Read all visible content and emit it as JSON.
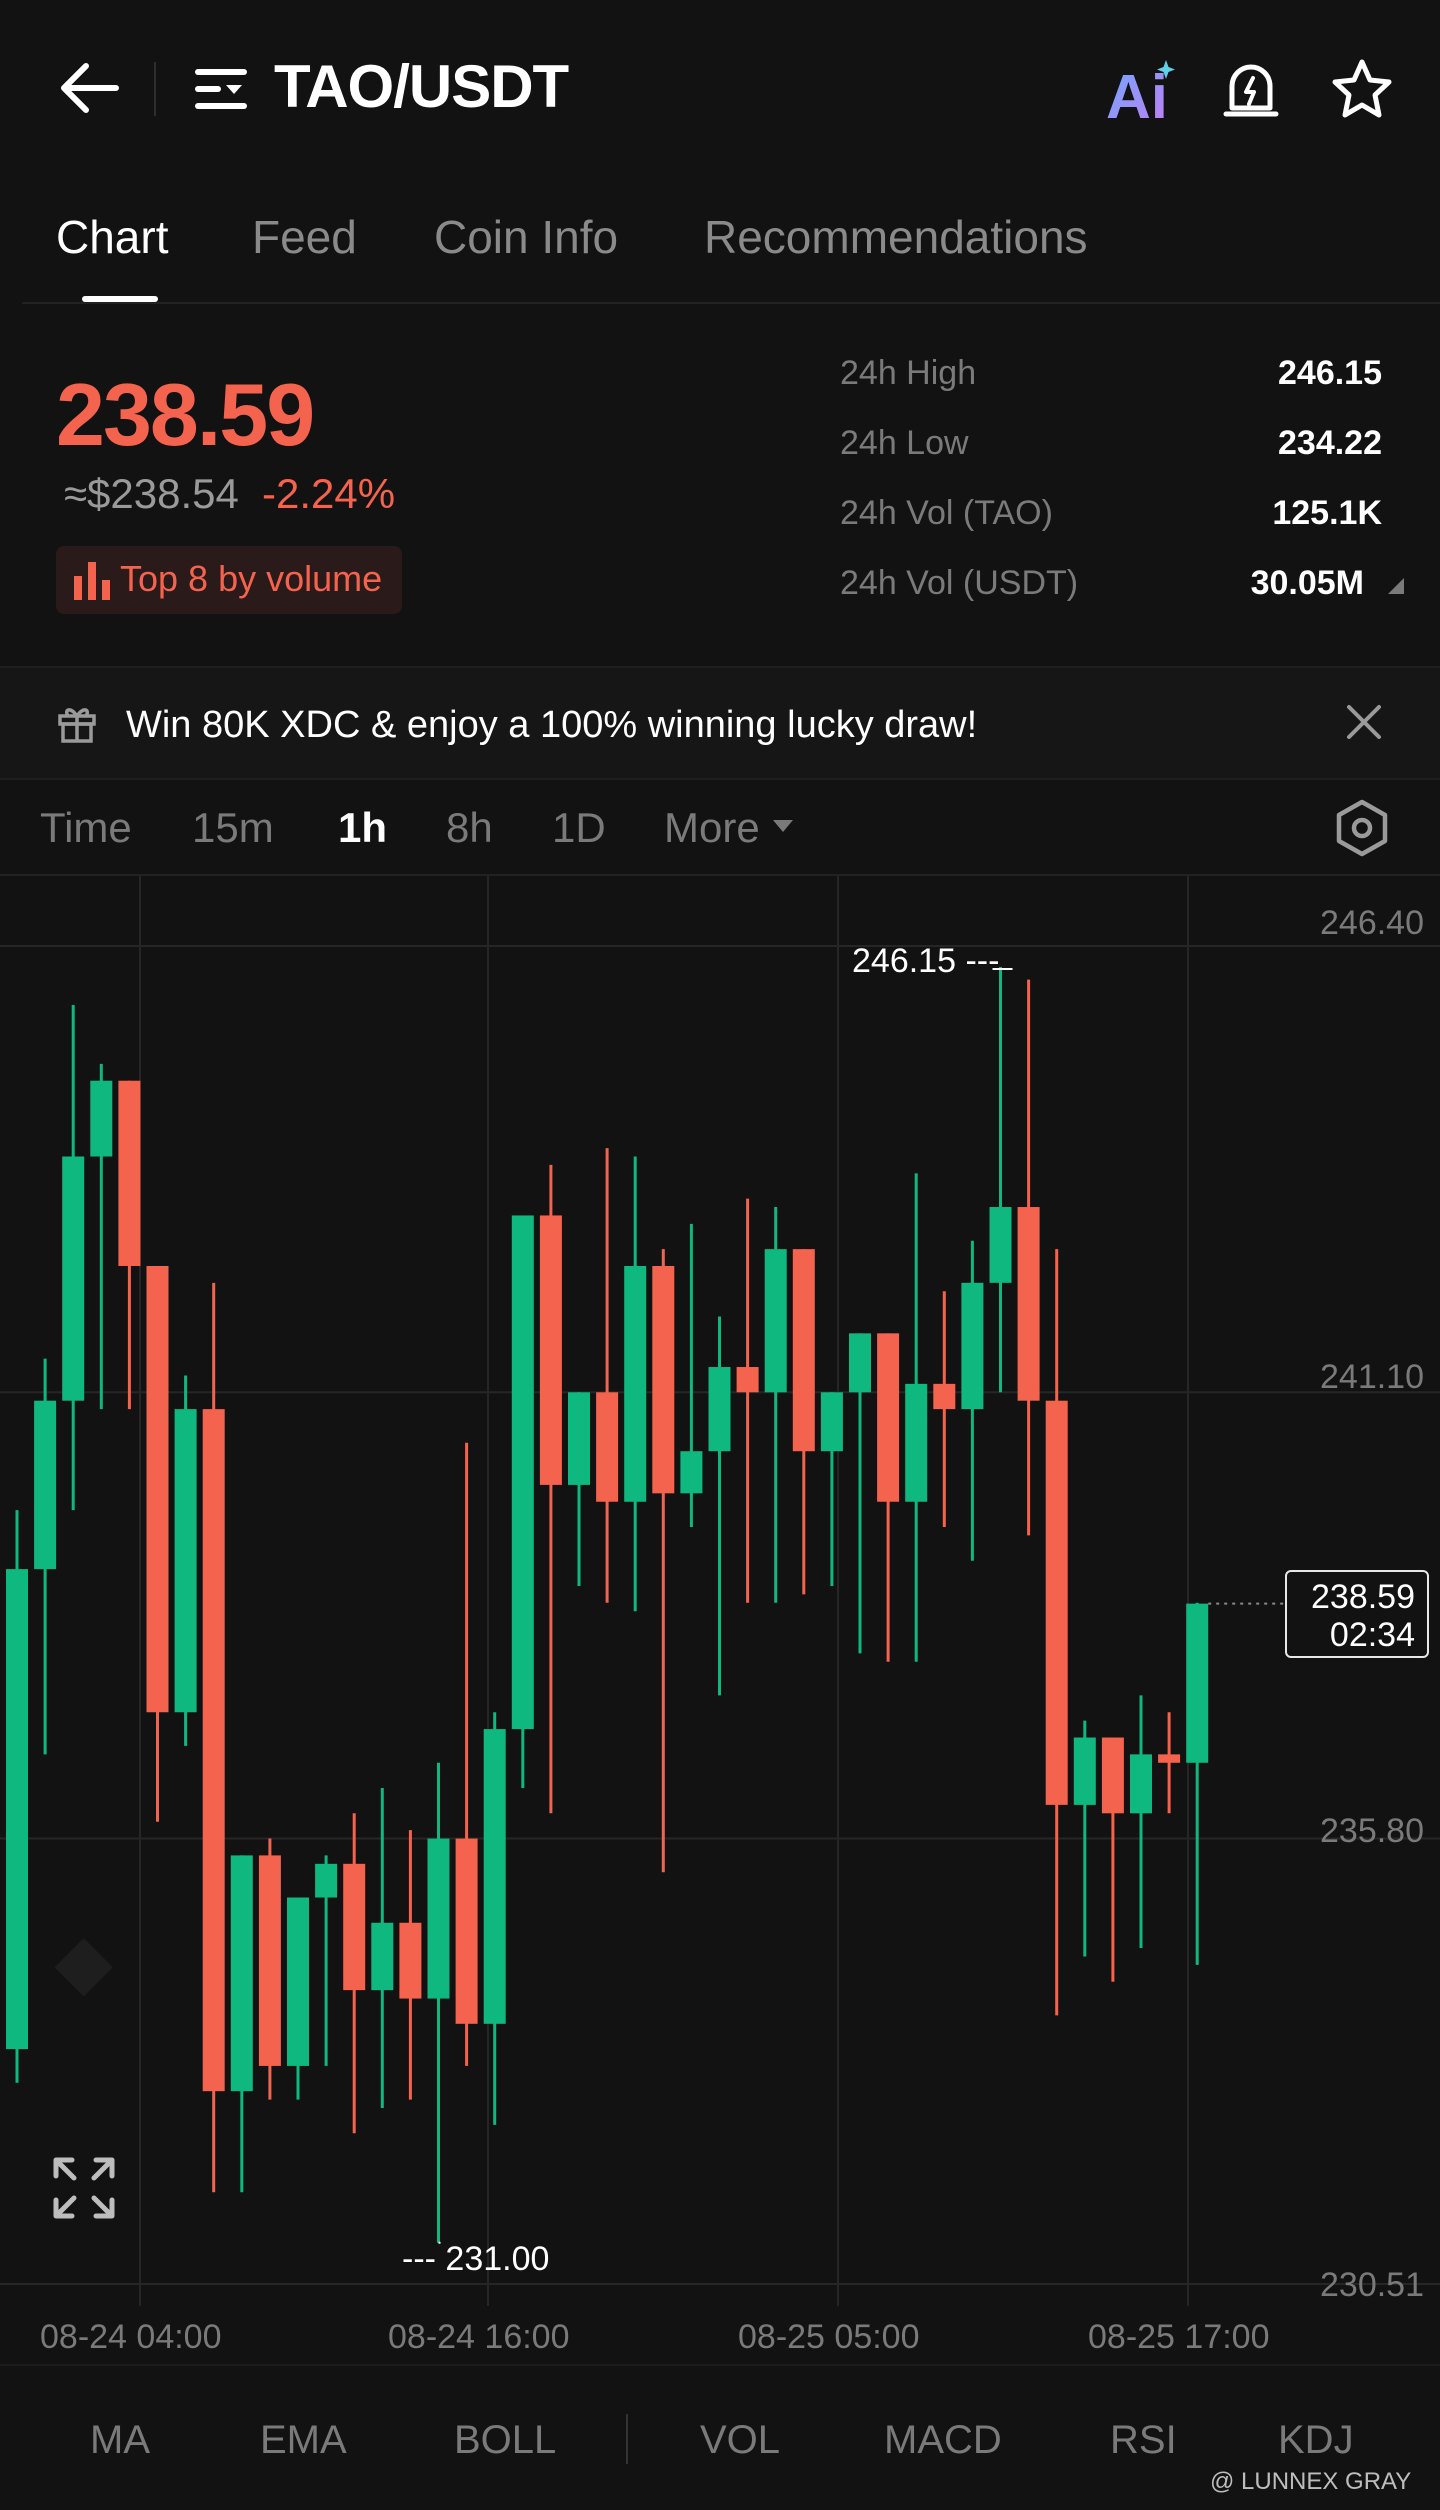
{
  "header": {
    "title": "TAO/USDT",
    "ai_label": "Ai"
  },
  "tabs": [
    {
      "label": "Chart",
      "active": true
    },
    {
      "label": "Feed"
    },
    {
      "label": "Coin Info"
    },
    {
      "label": "Recommendations"
    }
  ],
  "ticker": {
    "price": "238.59",
    "usd_price": "≈$238.54",
    "change": "-2.24%",
    "badge": "Top 8 by volume",
    "stats": [
      {
        "label": "24h High",
        "value": "246.15"
      },
      {
        "label": "24h Low",
        "value": "234.22"
      },
      {
        "label": "24h Vol (TAO)",
        "value": "125.1K"
      },
      {
        "label": "24h Vol (USDT)",
        "value": "30.05M"
      }
    ]
  },
  "promo": {
    "text": "Win 80K XDC & enjoy a 100% winning lucky draw!"
  },
  "intervals": [
    {
      "label": "Time"
    },
    {
      "label": "15m"
    },
    {
      "label": "1h",
      "active": true
    },
    {
      "label": "8h"
    },
    {
      "label": "1D"
    },
    {
      "label": "More"
    }
  ],
  "indicators": [
    "MA",
    "EMA",
    "BOLL",
    "VOL",
    "MACD",
    "RSI",
    "KDJ"
  ],
  "watermark": "@ LUNNEX GRAY",
  "colors": {
    "up": "#0fb87f",
    "down": "#f4634d",
    "accent_ai": "#8e7cf0"
  },
  "chart_data": {
    "type": "candlestick",
    "y_ticks": [
      "246.40",
      "241.10",
      "235.80",
      "230.51"
    ],
    "ylim": [
      230.51,
      246.4
    ],
    "x_ticks": [
      "08-24 04:00",
      "08-24 16:00",
      "08-25 05:00",
      "08-25 17:00"
    ],
    "high_marker": "246.15",
    "low_marker": "231.00",
    "last_price": "238.59",
    "countdown": "02:34",
    "candles": [
      {
        "o": 233.3,
        "h": 239.7,
        "l": 232.9,
        "c": 239.0
      },
      {
        "o": 239.0,
        "h": 241.5,
        "l": 236.8,
        "c": 241.0
      },
      {
        "o": 241.0,
        "h": 245.7,
        "l": 239.7,
        "c": 243.9
      },
      {
        "o": 243.9,
        "h": 245.0,
        "l": 240.9,
        "c": 244.8
      },
      {
        "o": 244.8,
        "h": 244.6,
        "l": 240.9,
        "c": 242.6
      },
      {
        "o": 242.6,
        "h": 242.6,
        "l": 236.0,
        "c": 237.3
      },
      {
        "o": 237.3,
        "h": 241.3,
        "l": 236.9,
        "c": 240.9
      },
      {
        "o": 240.9,
        "h": 242.4,
        "l": 231.6,
        "c": 232.8
      },
      {
        "o": 232.8,
        "h": 235.6,
        "l": 231.6,
        "c": 235.6
      },
      {
        "o": 235.6,
        "h": 235.8,
        "l": 232.7,
        "c": 233.1
      },
      {
        "o": 233.1,
        "h": 235.1,
        "l": 232.7,
        "c": 235.1
      },
      {
        "o": 235.1,
        "h": 235.6,
        "l": 233.1,
        "c": 235.5
      },
      {
        "o": 235.5,
        "h": 236.1,
        "l": 232.3,
        "c": 234.0
      },
      {
        "o": 234.0,
        "h": 236.4,
        "l": 232.6,
        "c": 234.8
      },
      {
        "o": 234.8,
        "h": 235.9,
        "l": 232.7,
        "c": 233.9
      },
      {
        "o": 233.9,
        "h": 236.7,
        "l": 231.0,
        "c": 235.8
      },
      {
        "o": 235.8,
        "h": 240.5,
        "l": 233.1,
        "c": 233.6
      },
      {
        "o": 233.6,
        "h": 237.3,
        "l": 232.4,
        "c": 237.1
      },
      {
        "o": 237.1,
        "h": 243.2,
        "l": 236.4,
        "c": 243.2
      },
      {
        "o": 243.2,
        "h": 243.8,
        "l": 236.1,
        "c": 240.0
      },
      {
        "o": 240.0,
        "h": 240.9,
        "l": 238.8,
        "c": 241.1
      },
      {
        "o": 241.1,
        "h": 244.0,
        "l": 238.6,
        "c": 239.8
      },
      {
        "o": 239.8,
        "h": 243.9,
        "l": 238.5,
        "c": 242.6
      },
      {
        "o": 242.6,
        "h": 242.8,
        "l": 235.4,
        "c": 239.9
      },
      {
        "o": 239.9,
        "h": 243.1,
        "l": 239.5,
        "c": 240.4
      },
      {
        "o": 240.4,
        "h": 242.0,
        "l": 237.5,
        "c": 241.4
      },
      {
        "o": 241.4,
        "h": 243.4,
        "l": 238.6,
        "c": 241.1
      },
      {
        "o": 241.1,
        "h": 243.3,
        "l": 238.6,
        "c": 242.8
      },
      {
        "o": 242.8,
        "h": 242.8,
        "l": 238.7,
        "c": 240.4
      },
      {
        "o": 240.4,
        "h": 240.5,
        "l": 238.8,
        "c": 241.1
      },
      {
        "o": 241.1,
        "h": 241.7,
        "l": 238.0,
        "c": 241.8
      },
      {
        "o": 241.8,
        "h": 241.8,
        "l": 237.9,
        "c": 239.8
      },
      {
        "o": 239.8,
        "h": 243.7,
        "l": 237.9,
        "c": 241.2
      },
      {
        "o": 241.2,
        "h": 242.3,
        "l": 239.5,
        "c": 240.9
      },
      {
        "o": 240.9,
        "h": 242.9,
        "l": 239.1,
        "c": 242.4
      },
      {
        "o": 242.4,
        "h": 246.15,
        "l": 241.1,
        "c": 243.3
      },
      {
        "o": 243.3,
        "h": 246.0,
        "l": 239.4,
        "c": 241.0
      },
      {
        "o": 241.0,
        "h": 242.8,
        "l": 233.7,
        "c": 236.2
      },
      {
        "o": 236.2,
        "h": 237.2,
        "l": 234.4,
        "c": 237.0
      },
      {
        "o": 237.0,
        "h": 236.6,
        "l": 234.1,
        "c": 236.1
      },
      {
        "o": 236.1,
        "h": 237.5,
        "l": 234.5,
        "c": 236.8
      },
      {
        "o": 236.8,
        "h": 237.3,
        "l": 236.1,
        "c": 236.7
      },
      {
        "o": 236.7,
        "h": 238.6,
        "l": 234.3,
        "c": 238.59
      }
    ]
  }
}
